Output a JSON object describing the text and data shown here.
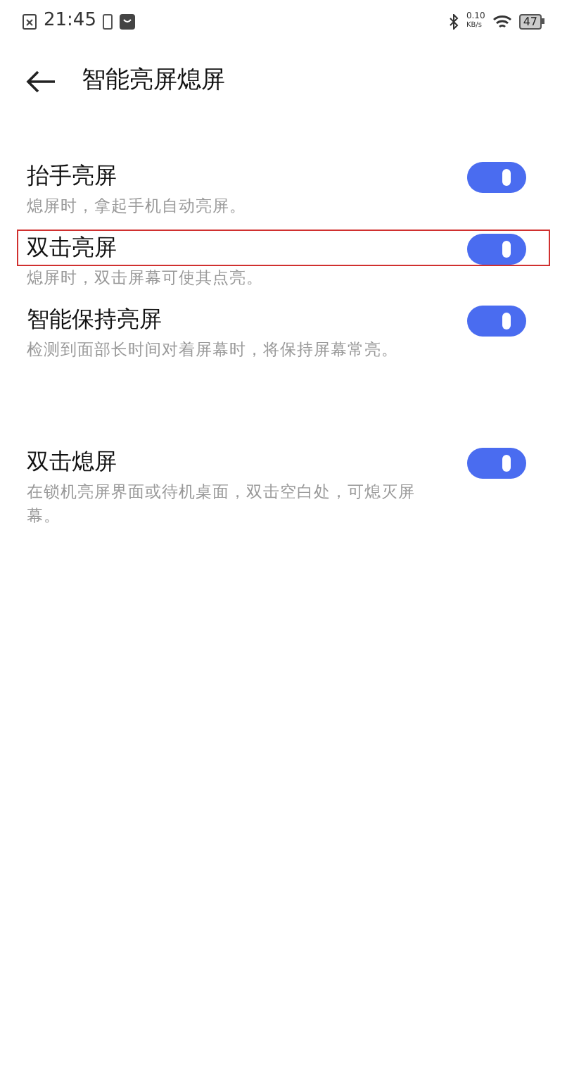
{
  "status_bar": {
    "time": "21:45",
    "speed_value": "0.10",
    "speed_unit": "KB/s",
    "battery": "47"
  },
  "header": {
    "title": "智能亮屏熄屏"
  },
  "groups": [
    {
      "items": [
        {
          "title": "抬手亮屏",
          "subtitle": "熄屏时，拿起手机自动亮屏。",
          "on": true,
          "highlighted": false
        },
        {
          "title": "双击亮屏",
          "subtitle": "熄屏时，双击屏幕可使其点亮。",
          "on": true,
          "highlighted": true
        },
        {
          "title": "智能保持亮屏",
          "subtitle": "检测到面部长时间对着屏幕时，将保持屏幕常亮。",
          "on": true,
          "highlighted": false
        }
      ]
    },
    {
      "items": [
        {
          "title": "双击熄屏",
          "subtitle": "在锁机亮屏界面或待机桌面，双击空白处，可熄灭屏幕。",
          "on": true,
          "highlighted": false
        }
      ]
    }
  ]
}
